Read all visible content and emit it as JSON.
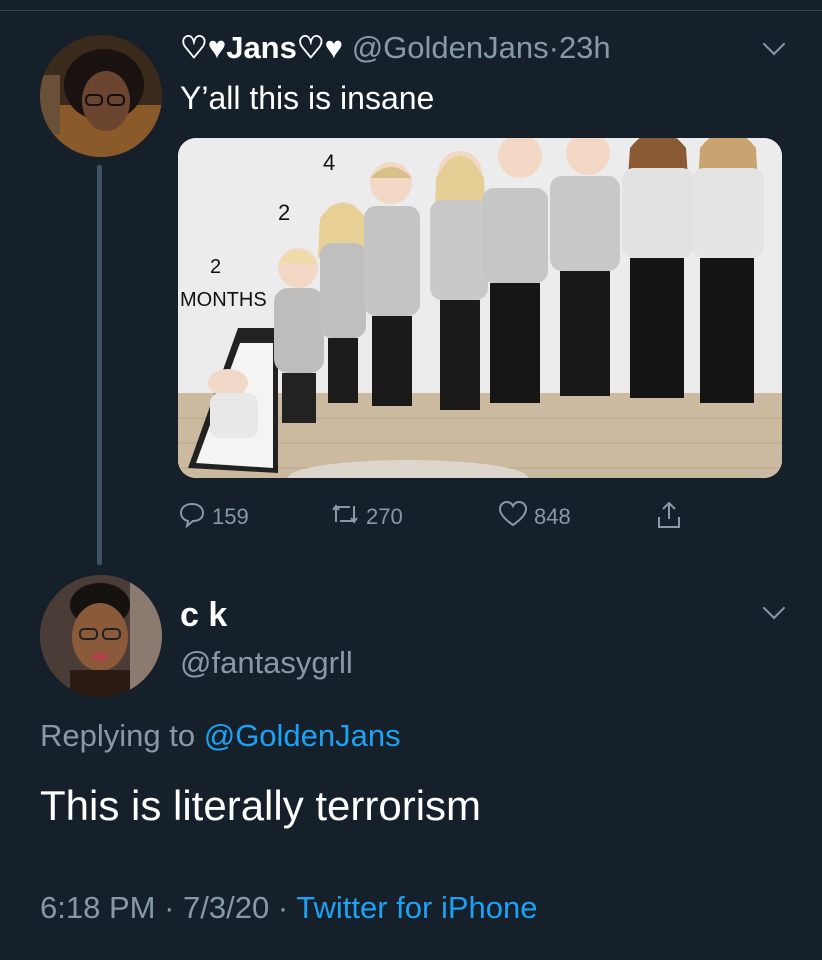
{
  "original_tweet": {
    "display_name": "♡♥Jans♡♥",
    "handle": "@GoldenJans",
    "separator": "·",
    "time": "23h",
    "text": "Y’all this is insane",
    "image_labels": {
      "four": "4",
      "two": "2",
      "two_months_number": "2",
      "two_months_word": "MONTHS"
    },
    "actions": {
      "reply_count": "159",
      "retweet_count": "270",
      "like_count": "848"
    }
  },
  "reply_tweet": {
    "display_name": "c k",
    "handle": "@fantasygrll",
    "replying_prefix": "Replying to",
    "replying_to": "@GoldenJans",
    "text": "This is literally terrorism",
    "time": "6:18 PM",
    "date": "7/3/20",
    "separator": "·",
    "source": "Twitter for iPhone"
  },
  "icons": [
    "reply-icon",
    "retweet-icon",
    "like-icon",
    "share-icon",
    "chevron-down-icon"
  ],
  "colors": {
    "background": "#15202b",
    "secondary_text": "#8899a6",
    "link": "#1da1f2"
  }
}
